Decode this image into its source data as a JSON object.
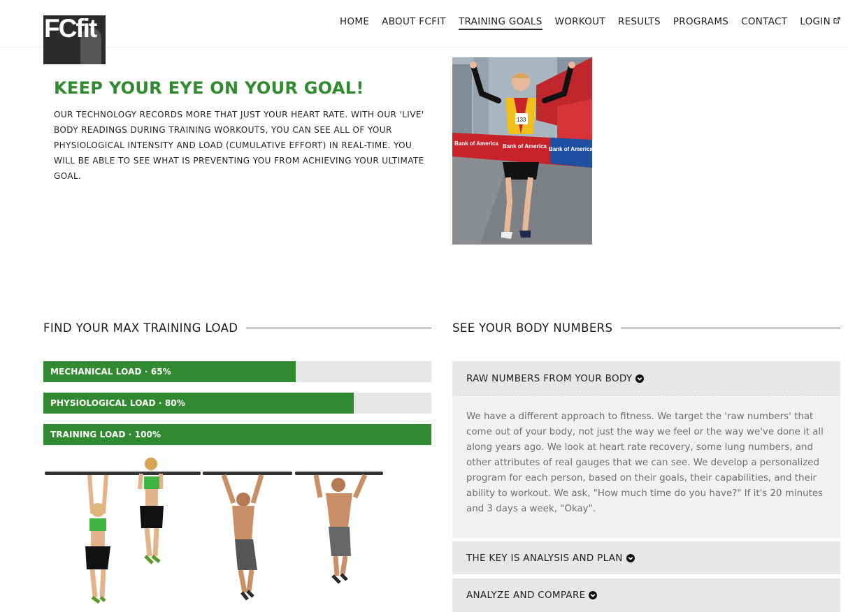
{
  "brand": {
    "logo_text": "FCfit"
  },
  "nav": {
    "items": [
      {
        "label": "HOME"
      },
      {
        "label": "ABOUT FCFIT"
      },
      {
        "label": "TRAINING GOALS",
        "active": true
      },
      {
        "label": "WORKOUT"
      },
      {
        "label": "RESULTS"
      },
      {
        "label": "PROGRAMS"
      },
      {
        "label": "CONTACT"
      },
      {
        "label": "LOGIN",
        "icon": "external-link-icon"
      }
    ]
  },
  "hero": {
    "title": "KEEP YOUR EYE ON YOUR GOAL!",
    "body": "OUR TECHNOLOGY RECORDS MORE THAT JUST YOUR HEART RATE. WITH OUR 'LIVE' BODY READINGS DURING TRAINING WORKOUTS, YOU CAN SEE ALL OF YOUR PHYSIOLOGICAL INTENSITY AND LOAD (CUMULATIVE EFFORT) IN REAL-TIME. YOU WILL BE ABLE TO SEE WHAT IS PREVENTING YOU FROM ACHIEVING YOUR ULTIMATE GOAL.",
    "photo": {
      "banner_text": [
        "Bank of America",
        "Bank of America",
        "Bank of America"
      ],
      "bib_number": "133"
    }
  },
  "training_load": {
    "heading": "FIND YOUR MAX TRAINING LOAD",
    "bars": [
      {
        "label": "MECHANICAL LOAD · 65%",
        "percent": 65
      },
      {
        "label": "PHYSIOLOGICAL LOAD · 80%",
        "percent": 80
      },
      {
        "label": "TRAINING LOAD · 100%",
        "percent": 100
      }
    ]
  },
  "body_numbers": {
    "heading": "SEE YOUR BODY NUMBERS",
    "accordion": [
      {
        "title": "RAW NUMBERS FROM YOUR BODY",
        "expanded": true,
        "content": "We have a different approach to fitness. We target the 'raw numbers' that come out of your body, not just the way we feel or the way we've done it all along years ago. We look at heart rate recovery, some lung numbers, and other attributes of real gauges that we can see. We develop a personalized program for each person, based on their goals, their capabilities, and their ability to workout. We ask, \"How much time do you have?\" If it's 20 minutes and 3 days a week, \"Okay\"."
      },
      {
        "title": "THE KEY IS ANALYSIS AND PLAN",
        "expanded": false
      },
      {
        "title": "ANALYZE AND COMPARE",
        "expanded": false
      }
    ]
  },
  "colors": {
    "accent": "#318a2f",
    "bar_track": "#e6e6e6",
    "accordion_bg": "#e7e7e7",
    "body_text": "#707070"
  }
}
